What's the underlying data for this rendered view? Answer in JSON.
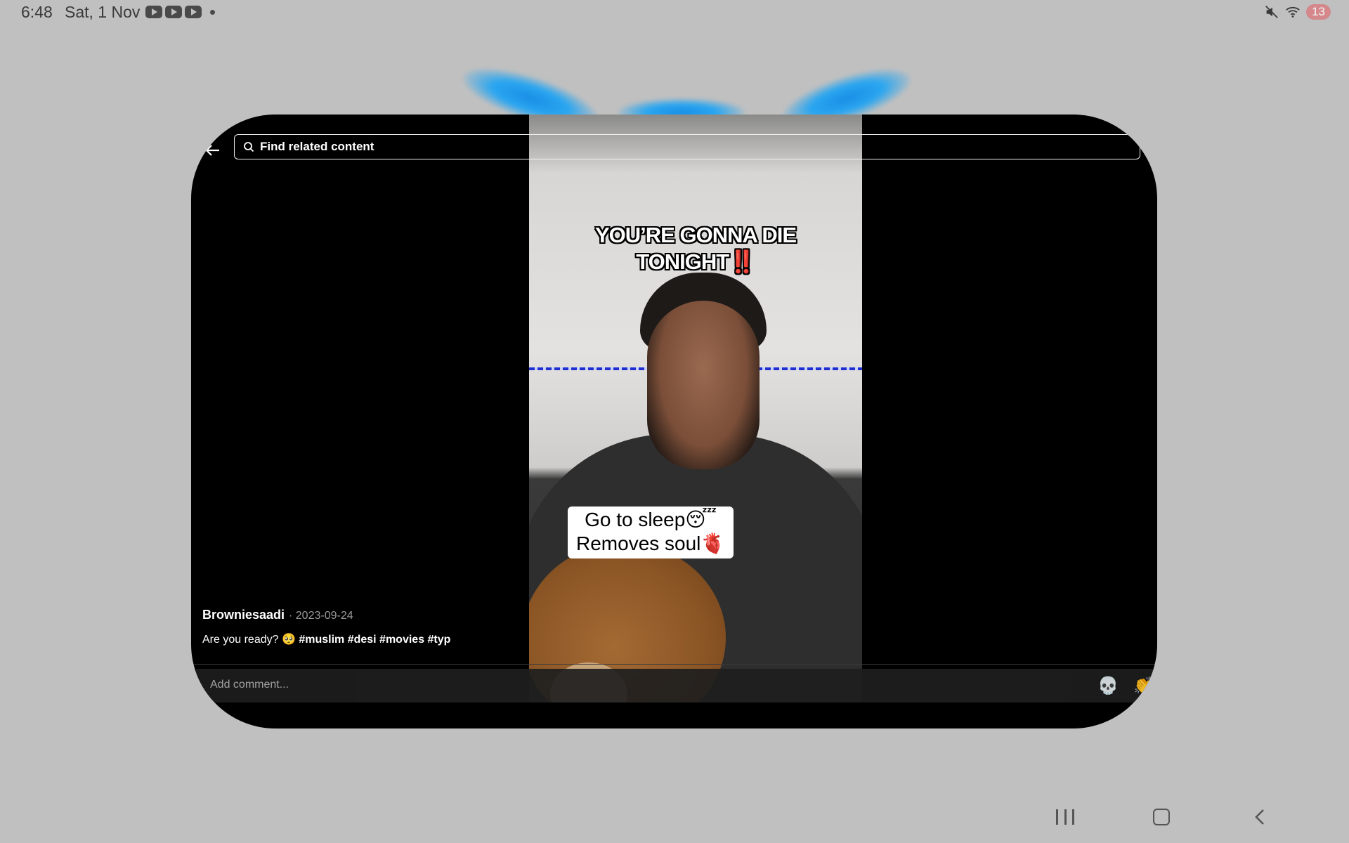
{
  "status_bar": {
    "time": "6:48",
    "date": "Sat, 1 Nov",
    "notification_icons": [
      "youtube-icon",
      "youtube-icon",
      "youtube-icon",
      "more-dot-icon"
    ],
    "battery": "13"
  },
  "search": {
    "placeholder": "Find related content"
  },
  "video": {
    "caption_top_line1": "YOU’RE GONNA DIE",
    "caption_top_line2": "TONIGHT",
    "caption_top_emoji": "‼️",
    "caption_box_line1": "Go to sleep😴",
    "caption_box_line2": "Removes soul🫀"
  },
  "post": {
    "author": "Browniesaadi",
    "date": "· 2023-09-24",
    "caption_text": "Are you ready? 🥺",
    "hashtags": "#muslim #desi #movies #typ"
  },
  "comment": {
    "placeholder": "Add comment...",
    "emoji_1": "💀",
    "emoji_2": "👏"
  },
  "colors": {
    "background": "#c0c0c0",
    "card": "#000000",
    "accent_glow": "#1a8ee6"
  }
}
